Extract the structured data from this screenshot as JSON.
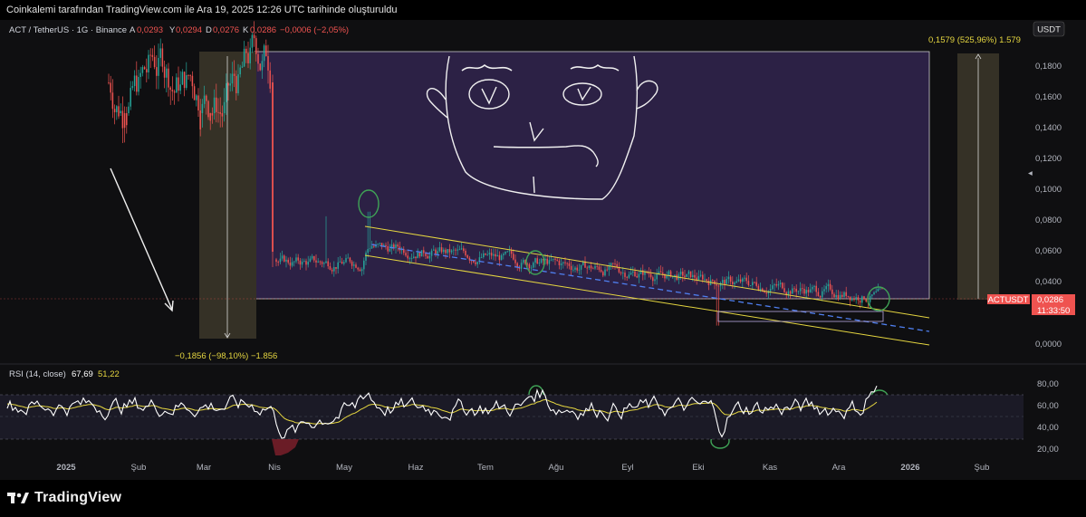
{
  "header": {
    "attribution": "Coinkalemi tarafından TradingView.com ile Ara 19, 2025 12:26 UTC tarihinde oluşturuldu"
  },
  "legend": {
    "symbol": "ACT / TetherUS · 1G · Binance",
    "open_label": "A",
    "open": "0,0293",
    "high_label": "Y",
    "high": "0,0294",
    "low_label": "D",
    "low": "0,0276",
    "close_label": "K",
    "close": "0,0286",
    "change": "−0,0006 (−2,05%)"
  },
  "currency_button": "USDT",
  "price_axis": [
    "0,1800",
    "0,1600",
    "0,1400",
    "0,1200",
    "0,1000",
    "0,0800",
    "0,0600",
    "0,0400",
    "0,0000"
  ],
  "current_price": {
    "symbol": "ACTUSDT",
    "price": "0,0286",
    "countdown": "11:33:50"
  },
  "measure_up": "0,1579 (525,96%) 1.579",
  "measure_down": "−0,1856 (−98,10%) −1.856",
  "rsi": {
    "label": "RSI (14, close)",
    "value": "67,69",
    "ma": "51,22",
    "axis": [
      "80,00",
      "60,00",
      "40,00",
      "20,00"
    ]
  },
  "time_axis": [
    "2025",
    "Şub",
    "Mar",
    "Nis",
    "May",
    "Haz",
    "Tem",
    "Ağu",
    "Eyl",
    "Eki",
    "Kas",
    "Ara",
    "2026",
    "Şub"
  ],
  "brand": "TradingView",
  "colors": {
    "up": "#26a69a",
    "down": "#ef5350",
    "channel": "#e5d640",
    "box": "#3a2a5c",
    "rsi_line": "#ffffff",
    "rsi_ma": "#e5d640",
    "price_tag": "#ef5350"
  },
  "chart_data": {
    "type": "candlestick",
    "price_unit": "USDT",
    "current_close": 0.0286,
    "visible_range_high": 0.19,
    "pre_crash_range": [
      0.14,
      0.19
    ],
    "crash_date": "2025-04",
    "post_crash_price": 0.055,
    "peak_after_crash": {
      "date": "2025-05",
      "price": 0.083
    },
    "channel_upper": [
      [
        "2025-05-10",
        0.076
      ],
      [
        "2025-12-28",
        0.017
      ]
    ],
    "channel_lower": [
      [
        "2025-05-10",
        0.058
      ],
      [
        "2025-12-28",
        0.0
      ]
    ],
    "channel_mid": [
      [
        "2025-05-10",
        0.062
      ],
      [
        "2025-12-28",
        0.008
      ]
    ],
    "measure_down": {
      "change": -0.1856,
      "percent": -98.1
    },
    "measure_up": {
      "change": 0.1579,
      "percent": 525.96
    },
    "rsi_current": 67.69,
    "rsi_ma_current": 51.22,
    "rsi_levels": [
      70,
      30
    ]
  }
}
